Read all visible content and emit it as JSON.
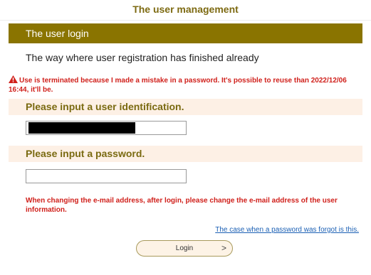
{
  "header": {
    "title": "The user management"
  },
  "section": {
    "title": "The user login"
  },
  "status_message": "The way where user registration has finished already",
  "warning": {
    "icon": "warning-triangle-icon",
    "text": "Use is terminated because I made a mistake in a password. It's possible to reuse than 2022/12/06 16:44, it'll be."
  },
  "user_id": {
    "label": "Please input a user identification.",
    "value": "",
    "redacted": true
  },
  "password": {
    "label": "Please input a password.",
    "value": ""
  },
  "note": "When changing the e-mail address, after login, please change the e-mail address of the user information.",
  "forgot_link": "The case when a password was forgot is this.",
  "login_button": {
    "label": "Login",
    "icon": "chevron-right-icon",
    "arrow": ">"
  },
  "colors": {
    "accent": "#8a7400",
    "heading_text": "#7a6a10",
    "field_bg": "#fdf0e5",
    "warning": "#d0201b",
    "link": "#1a5fb4"
  }
}
